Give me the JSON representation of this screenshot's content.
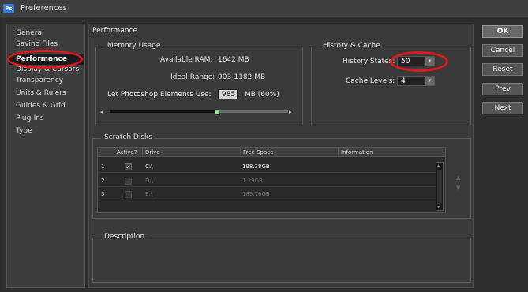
{
  "window": {
    "title": "Preferences",
    "app_icon": "Ps"
  },
  "sidebar": {
    "items": [
      {
        "label": "General",
        "selected": false
      },
      {
        "label": "Saving Files",
        "selected": false
      },
      {
        "label": "Performance",
        "selected": true
      },
      {
        "label": "Display & Cursors",
        "selected": false
      },
      {
        "label": "Transparency",
        "selected": false
      },
      {
        "label": "Units & Rulers",
        "selected": false
      },
      {
        "label": "Guides & Grid",
        "selected": false
      },
      {
        "label": "Plug-Ins",
        "selected": false
      },
      {
        "label": "Type",
        "selected": false
      }
    ]
  },
  "panel": {
    "title": "Performance",
    "memory": {
      "group_label": "Memory Usage",
      "available_ram_label": "Available RAM:",
      "available_ram_value": "1642 MB",
      "ideal_range_label": "Ideal Range:",
      "ideal_range_value": "903-1182 MB",
      "use_label": "Let Photoshop Elements Use:",
      "use_value": "985",
      "use_unit": "MB (60%)",
      "slider_fraction": 0.6
    },
    "history": {
      "group_label": "History & Cache",
      "history_states_label": "History States:",
      "history_states_value": "50",
      "cache_levels_label": "Cache Levels:",
      "cache_levels_value": "4"
    },
    "scratch": {
      "group_label": "Scratch Disks",
      "columns": [
        "Active?",
        "Drive",
        "Free Space",
        "Information"
      ],
      "rows": [
        {
          "index": "1",
          "active": true,
          "drive": "C:\\",
          "free": "198.38GB",
          "info": "",
          "enabled": true
        },
        {
          "index": "2",
          "active": false,
          "drive": "D:\\",
          "free": "1.29GB",
          "info": "",
          "enabled": false
        },
        {
          "index": "3",
          "active": false,
          "drive": "E:\\",
          "free": "189.76GB",
          "info": "",
          "enabled": false
        }
      ]
    },
    "description": {
      "group_label": "Description"
    }
  },
  "buttons": {
    "ok": "OK",
    "cancel": "Cancel",
    "reset": "Reset",
    "prev": "Prev",
    "next": "Next"
  },
  "colors": {
    "highlight_circle": "#e01818",
    "selected_item_bg": "#1a1a1a"
  }
}
